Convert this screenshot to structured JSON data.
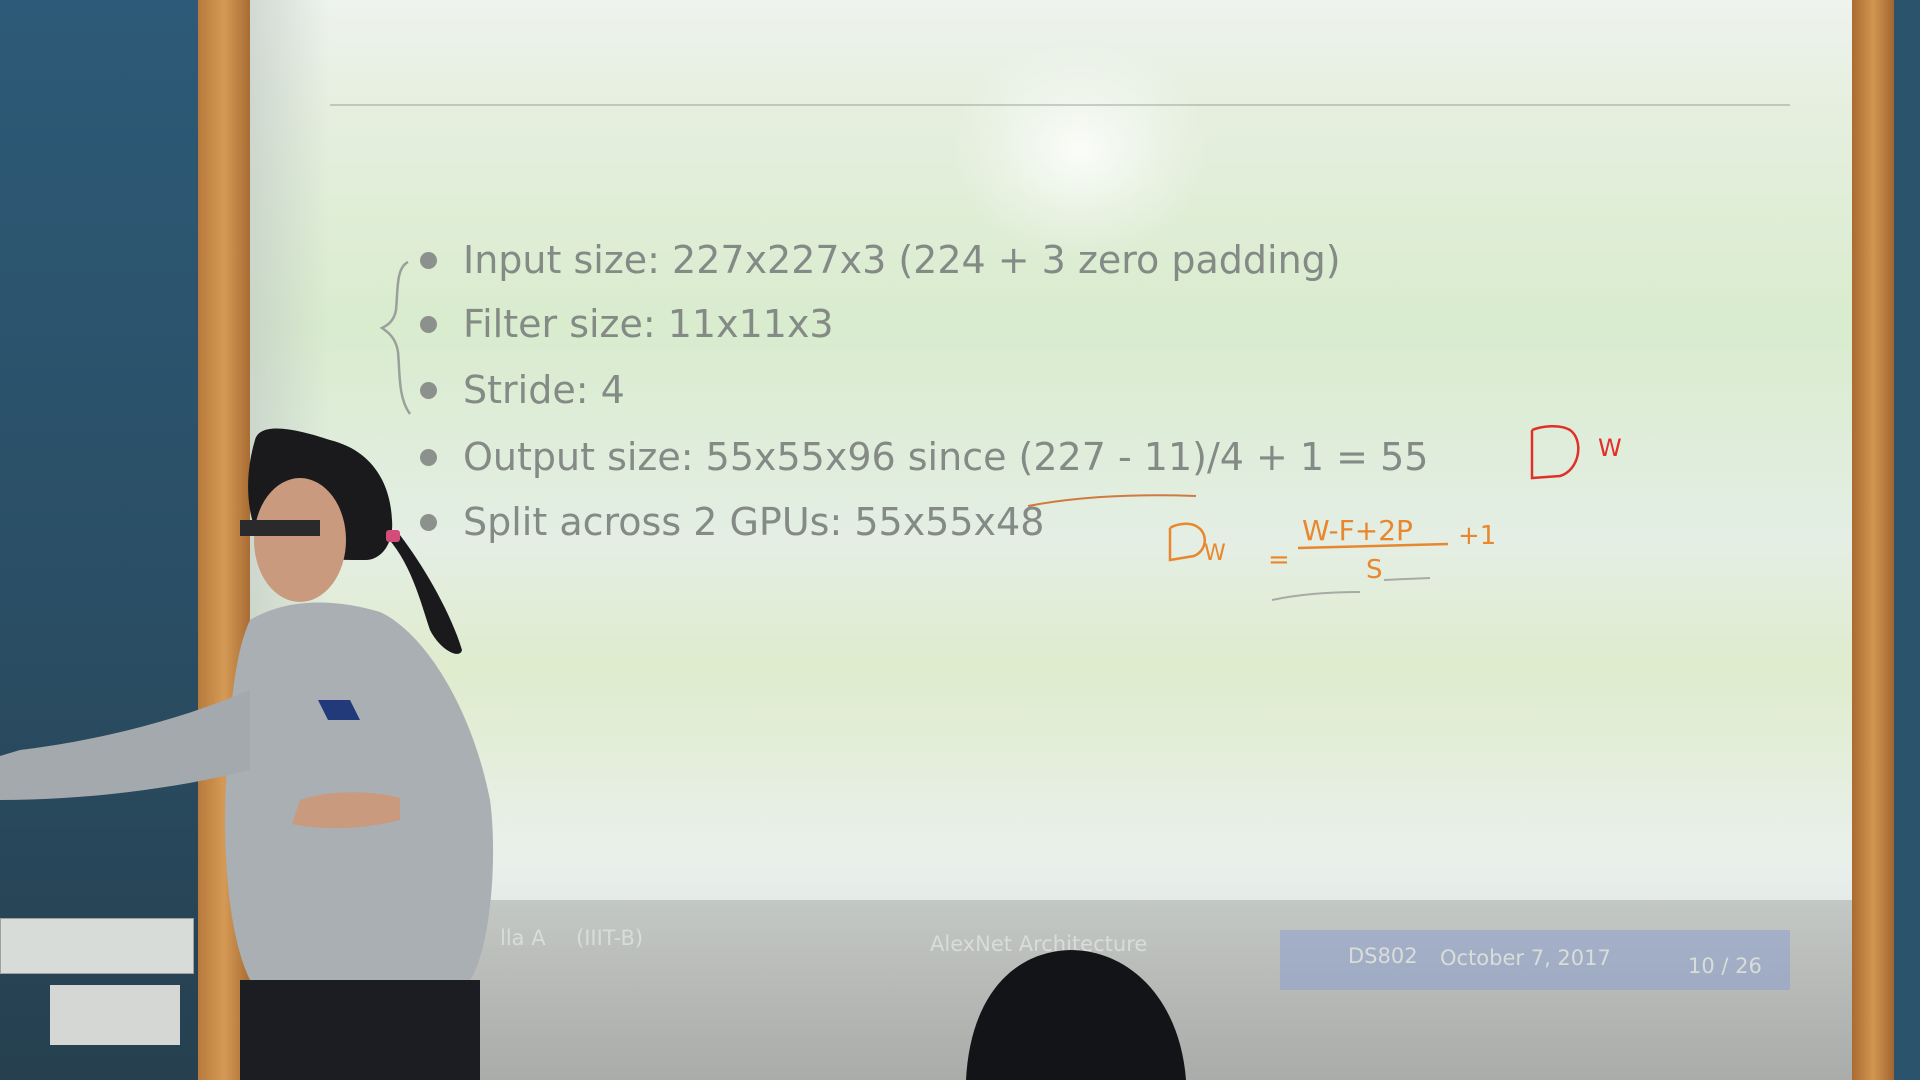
{
  "slide": {
    "bullets": [
      "Input size: 227x227x3 (224 + 3 zero padding)",
      "Filter size: 11x11x3",
      "Stride: 4",
      "Output size: 55x55x96 since (227 - 11)/4 + 1 = 55",
      "Split across 2 GPUs: 55x55x48"
    ],
    "footer": {
      "author": "lla A",
      "institution": "(IIIT-B)",
      "title": "AlexNet Architecture",
      "course": "DS802",
      "date": "October 7, 2017",
      "page": "10 / 26"
    }
  },
  "annotations": {
    "equation_numerator": "W-F+2P",
    "equation_plus": "+1",
    "equation_denominator": "S",
    "equation_lhs": "D",
    "equation_sub": "W",
    "corner_label": "D",
    "corner_sub": "W"
  },
  "colors": {
    "slide_text": "#848a86",
    "ink_red": "#e0302a",
    "ink_orange": "#e8872e",
    "frame_wood": "#c88a47"
  }
}
